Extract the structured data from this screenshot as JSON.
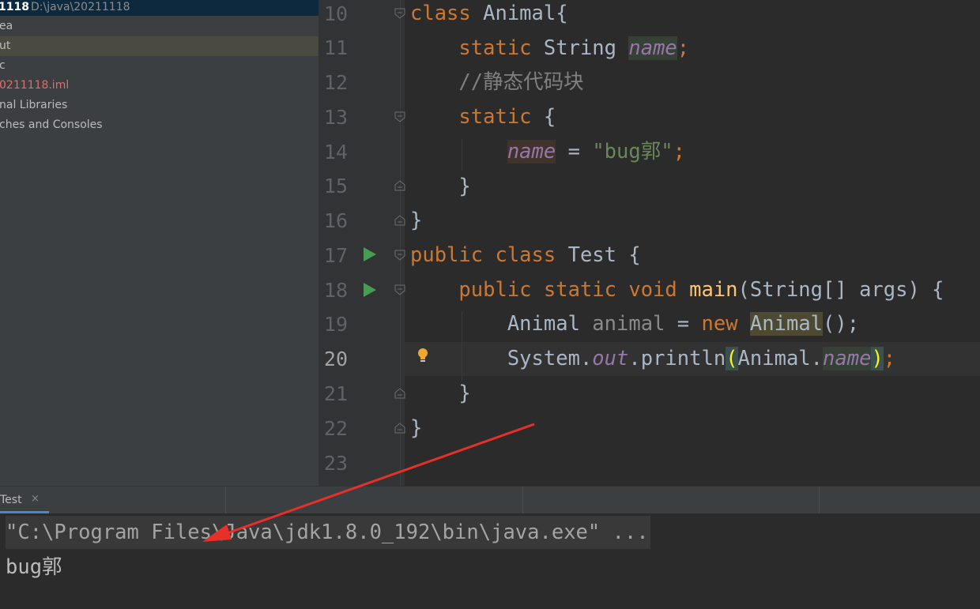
{
  "sidebar": {
    "project_name": "1118",
    "project_path": "D:\\java\\20211118",
    "items": [
      {
        "label": "ea"
      },
      {
        "label": "ut"
      },
      {
        "label": "c"
      },
      {
        "label": "0211118.iml"
      },
      {
        "label": "nal Libraries"
      },
      {
        "label": "ches and Consoles"
      }
    ]
  },
  "editor": {
    "line_numbers": [
      "10",
      "11",
      "12",
      "13",
      "14",
      "15",
      "16",
      "17",
      "18",
      "19",
      "20",
      "21",
      "22",
      "23"
    ],
    "current_line": "20",
    "code": {
      "l10": {
        "kw": "class",
        "name": " Animal{"
      },
      "l11": {
        "kw": "static",
        "type": " String ",
        "field": "name",
        "semi": ";"
      },
      "l12": {
        "comment": "//静态代码块"
      },
      "l13": {
        "kw": "static",
        "rest": " {"
      },
      "l14": {
        "field": "name",
        "op": " = ",
        "str": "\"bug郭\"",
        "semi": ";"
      },
      "l15": {
        "text": "}"
      },
      "l16": {
        "text": "}"
      },
      "l17": {
        "kw": "public class",
        "rest": " Test {"
      },
      "l18": {
        "kw": "public static void",
        "sp": " ",
        "method": "main",
        "rest": "(String[] args) {"
      },
      "l19": {
        "type": "Animal ",
        "var": "animal",
        "op": " = ",
        "kw": "new",
        "sp": " ",
        "cls": "Animal",
        "rest": "();"
      },
      "l20": {
        "obj": "System.",
        "field": "out",
        "call": ".println",
        "open": "(",
        "arg": "Animal.",
        "argfield": "name",
        "close": ")",
        "semi": ";"
      },
      "l21": {
        "text": "}"
      },
      "l22": {
        "text": "}"
      }
    }
  },
  "run_panel": {
    "tab_label": "Test",
    "tab_close": "×"
  },
  "console": {
    "command": "\"C:\\Program Files\\Java\\jdk1.8.0_192\\bin\\java.exe\" ...",
    "output": "bug郭"
  },
  "colors": {
    "keyword": "#cc7832",
    "field": "#9876aa",
    "string": "#6a8759",
    "comment": "#808080",
    "method": "#ffc66d",
    "annotation_arrow": "#e8302a"
  },
  "icons": [
    "run-icon",
    "fold-icon",
    "lightbulb-icon",
    "close-icon"
  ]
}
